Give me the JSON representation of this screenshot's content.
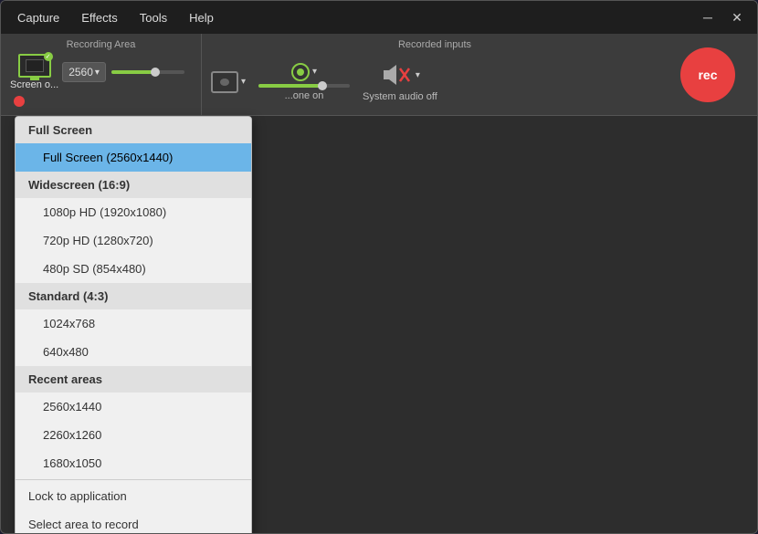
{
  "titleBar": {
    "menuItems": [
      "Capture",
      "Effects",
      "Tools",
      "Help"
    ],
    "minimizeLabel": "─",
    "closeLabel": "✕"
  },
  "toolbar": {
    "recordingArea": {
      "label": "Recording Area",
      "resolution": "2560",
      "screenLabel": "Screen o...",
      "dropdownArrow": "▾"
    },
    "recordedInputs": {
      "label": "Recorded inputs",
      "microphoneLabel": "...one on",
      "systemAudioLabel": "System audio off",
      "dropdownArrow": "▾"
    },
    "recButton": "rec"
  },
  "dropdownMenu": {
    "sections": [
      {
        "header": "Full Screen",
        "items": [
          {
            "label": "Full Screen (2560x1440)",
            "selected": true
          }
        ]
      },
      {
        "header": "Widescreen (16:9)",
        "items": [
          {
            "label": "1080p HD (1920x1080)",
            "selected": false
          },
          {
            "label": "720p HD (1280x720)",
            "selected": false
          },
          {
            "label": "480p SD (854x480)",
            "selected": false
          }
        ]
      },
      {
        "header": "Standard (4:3)",
        "items": [
          {
            "label": "1024x768",
            "selected": false
          },
          {
            "label": "640x480",
            "selected": false
          }
        ]
      },
      {
        "header": "Recent areas",
        "items": [
          {
            "label": "2560x1440",
            "selected": false
          },
          {
            "label": "2260x1260",
            "selected": false
          },
          {
            "label": "1680x1050",
            "selected": false
          }
        ]
      }
    ],
    "actions": [
      {
        "label": "Lock to application"
      },
      {
        "label": "Select area to record"
      }
    ]
  }
}
